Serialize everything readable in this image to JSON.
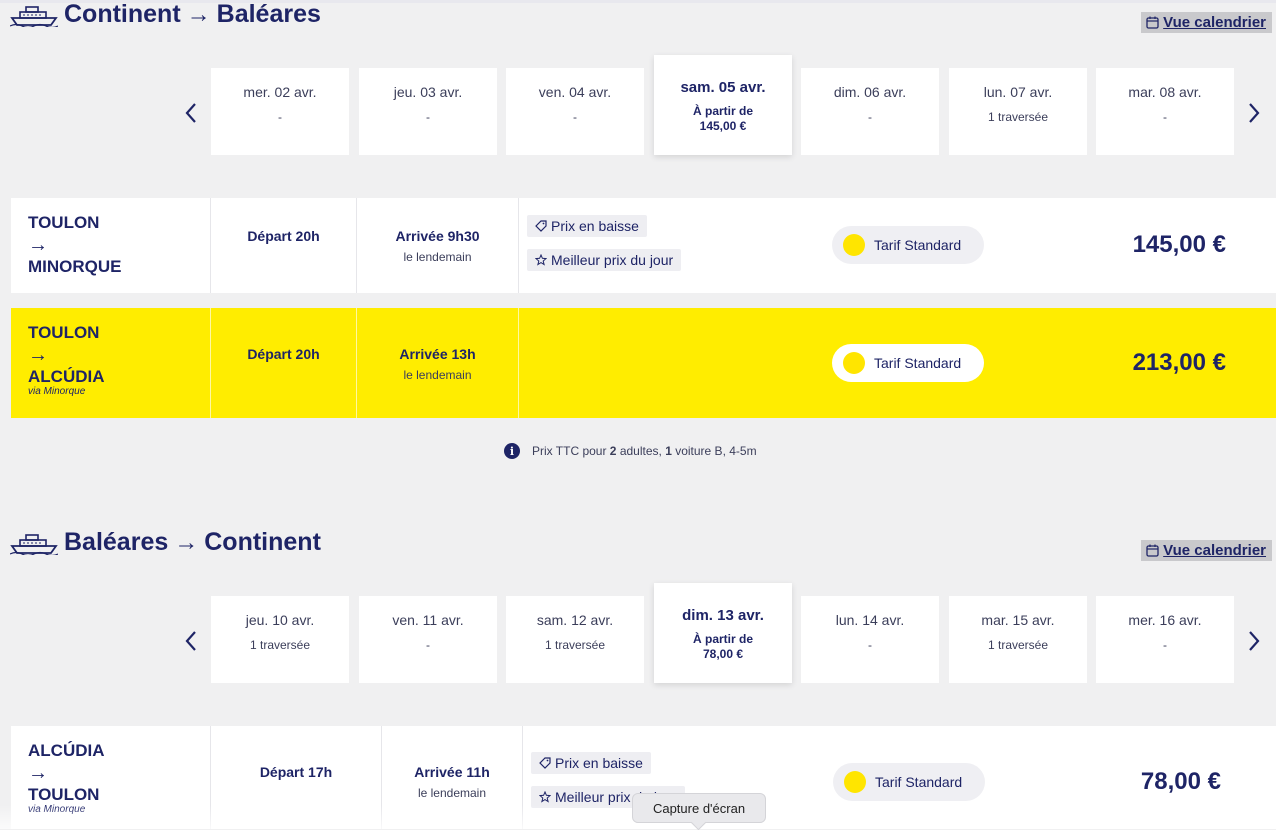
{
  "outbound": {
    "title_from": "Continent",
    "title_to": "Baléares",
    "calendar_label": "Vue calendrier",
    "days": [
      {
        "label": "mer. 02 avr.",
        "sub": "-"
      },
      {
        "label": "jeu. 03 avr.",
        "sub": "-"
      },
      {
        "label": "ven. 04 avr.",
        "sub": "-"
      },
      {
        "label": "sam. 05 avr.",
        "sub1": "À partir de",
        "sub2": "145,00 €"
      },
      {
        "label": "dim. 06 avr.",
        "sub": "-"
      },
      {
        "label": "lun. 07 avr.",
        "sub": "1 traversée"
      },
      {
        "label": "mar. 08 avr.",
        "sub": "-"
      }
    ],
    "rows": [
      {
        "from": "TOULON",
        "to": "MINORQUE",
        "depart": "Départ 20h",
        "arrive": "Arrivée 9h30",
        "arrive_sub": "le lendemain",
        "tag1": "Prix en baisse",
        "tag2": "Meilleur prix du jour",
        "tarif": "Tarif Standard",
        "price": "145,00 €"
      },
      {
        "from": "TOULON",
        "to": "ALCÚDIA",
        "via": "via Minorque",
        "depart": "Départ 20h",
        "arrive": "Arrivée 13h",
        "arrive_sub": "le lendemain",
        "tarif": "Tarif Standard",
        "price": "213,00 €"
      }
    ]
  },
  "info": {
    "prefix": "Prix TTC pour ",
    "adults_count": "2",
    "adults_text": " adultes, ",
    "car_count": "1",
    "car_text": " voiture B, 4-5m"
  },
  "inbound": {
    "title_from": "Baléares",
    "title_to": "Continent",
    "calendar_label": "Vue calendrier",
    "days": [
      {
        "label": "jeu. 10 avr.",
        "sub": "1 traversée"
      },
      {
        "label": "ven. 11 avr.",
        "sub": "-"
      },
      {
        "label": "sam. 12 avr.",
        "sub": "1 traversée"
      },
      {
        "label": "dim. 13 avr.",
        "sub1": "À partir de",
        "sub2": "78,00 €"
      },
      {
        "label": "lun. 14 avr.",
        "sub": "-"
      },
      {
        "label": "mar. 15 avr.",
        "sub": "1 traversée"
      },
      {
        "label": "mer. 16 avr.",
        "sub": "-"
      }
    ],
    "rows": [
      {
        "from": "ALCÚDIA",
        "to": "TOULON",
        "via": "via Minorque",
        "depart": "Départ 17h",
        "arrive": "Arrivée 11h",
        "arrive_sub": "le lendemain",
        "tag1": "Prix en baisse",
        "tag2": "Meilleur prix du jour",
        "tarif": "Tarif Standard",
        "price": "78,00 €"
      }
    ]
  },
  "tooltip": "Capture d'écran",
  "colors": {
    "navy": "#1e2466",
    "highlight": "#ffed00",
    "dot": "#ffe500"
  },
  "icons": {
    "ship": "ship-icon",
    "calendar": "calendar-icon",
    "prev": "chevron-left-icon",
    "next": "chevron-right-icon",
    "tag": "price-tag-icon",
    "star": "star-icon",
    "info": "info-icon"
  }
}
